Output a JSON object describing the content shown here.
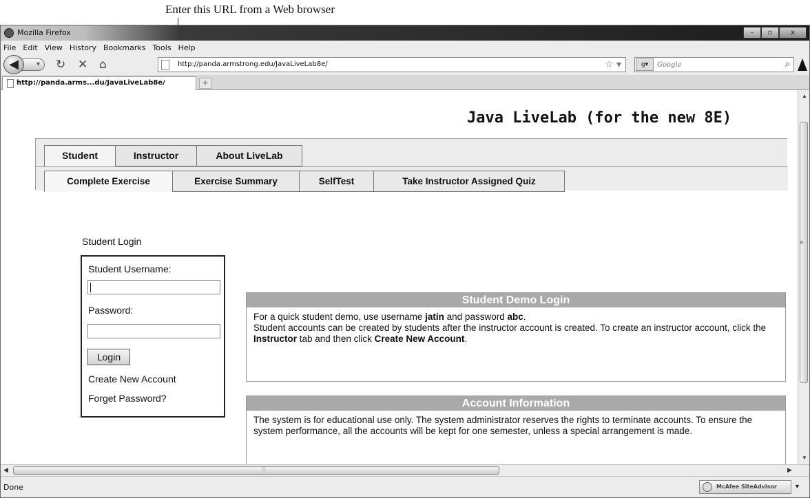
{
  "annotation": "Enter this URL from a Web browser",
  "window": {
    "title": "Mozilla Firefox",
    "buttons": [
      "–",
      "▫",
      "x"
    ]
  },
  "menu": [
    "File",
    "Edit",
    "View",
    "History",
    "Bookmarks",
    "Tools",
    "Help"
  ],
  "nav": {
    "url": "http://panda.armstrong.edu/JavaLiveLab8e/",
    "search_placeholder": "Google",
    "search_engine_icon": "google-icon"
  },
  "tab": {
    "title": "http://panda.arms...du/JavaLiveLab8e/",
    "new_tab": "+"
  },
  "page": {
    "heading": "Java LiveLab (for the new 8E)",
    "main_tabs": [
      "Student",
      "Instructor",
      "About LiveLab"
    ],
    "sub_tabs": [
      "Complete Exercise",
      "Exercise Summary",
      "SelfTest",
      "Take Instructor Assigned Quiz"
    ],
    "login": {
      "caption": "Student Login",
      "username_label": "Student Username:",
      "password_label": "Password:",
      "login_button": "Login",
      "create_account": "Create New Account",
      "forget_password": "Forget Password?"
    },
    "demo_panel": {
      "title": "Student Demo Login",
      "line1_before": "For a quick student demo, use username ",
      "username": "jatin",
      "line1_mid": " and password ",
      "password": "abc",
      "line1_end": ".",
      "line2_before": "Student accounts can be created by students after the instructor account is created. To create an instructor account, click the ",
      "instructor_word": "Instructor",
      "line2_mid": " tab and then click ",
      "create_word": "Create New Account",
      "line2_end": "."
    },
    "account_panel": {
      "title": "Account Information",
      "text": "The system is for educational use only. The system administrator reserves the rights to terminate accounts. To ensure the system performance, all the accounts will be kept for one semester, unless a special arrangement is made."
    }
  },
  "status": {
    "text": "Done",
    "addon": "McAfee SiteAdvisor"
  }
}
